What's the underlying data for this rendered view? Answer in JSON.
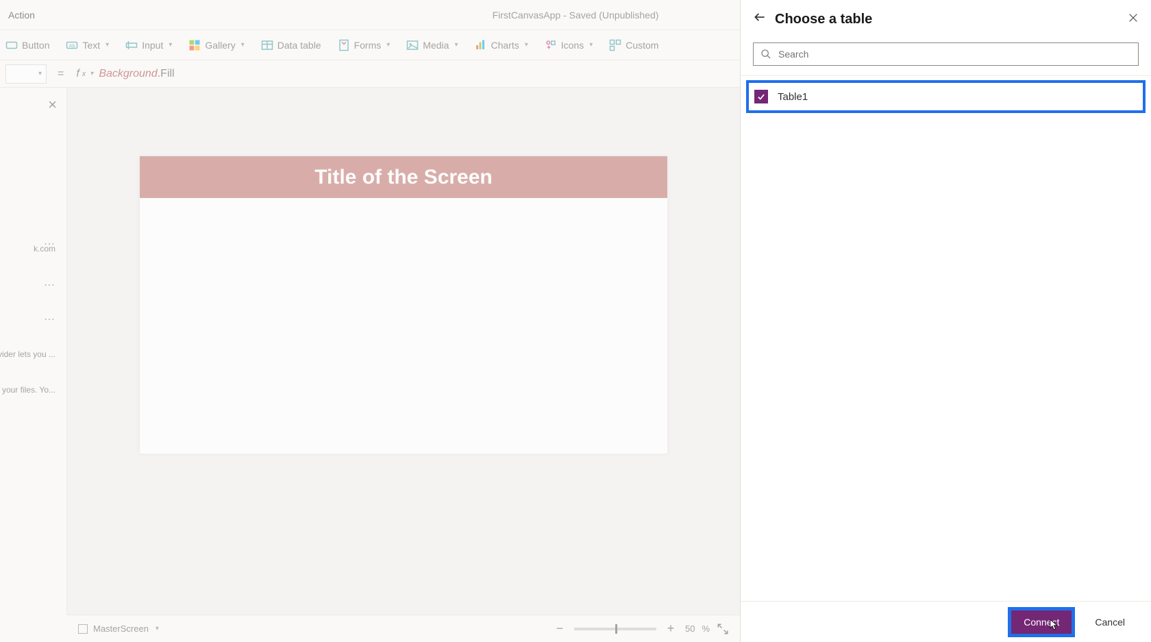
{
  "topbar": {
    "menu_tab": "Action",
    "window_title": "FirstCanvasApp - Saved (Unpublished)"
  },
  "ribbon": {
    "button": "Button",
    "text": "Text",
    "input": "Input",
    "gallery": "Gallery",
    "datatable": "Data table",
    "forms": "Forms",
    "media": "Media",
    "charts": "Charts",
    "icons": "Icons",
    "custom": "Custom"
  },
  "formula": {
    "object": "Background",
    "prop": ".Fill"
  },
  "left_fragments": {
    "f1": "k.com",
    "f2": "ovider lets you ...",
    "f3": "e your files. Yo..."
  },
  "canvas": {
    "screen_title": "Title of the Screen"
  },
  "statusbar": {
    "screen_name": "MasterScreen",
    "zoom_value": "50",
    "zoom_unit": "%"
  },
  "rpanel": {
    "title": "Choose a table",
    "search_placeholder": "Search",
    "table1": "Table1",
    "connect": "Connect",
    "cancel": "Cancel"
  }
}
